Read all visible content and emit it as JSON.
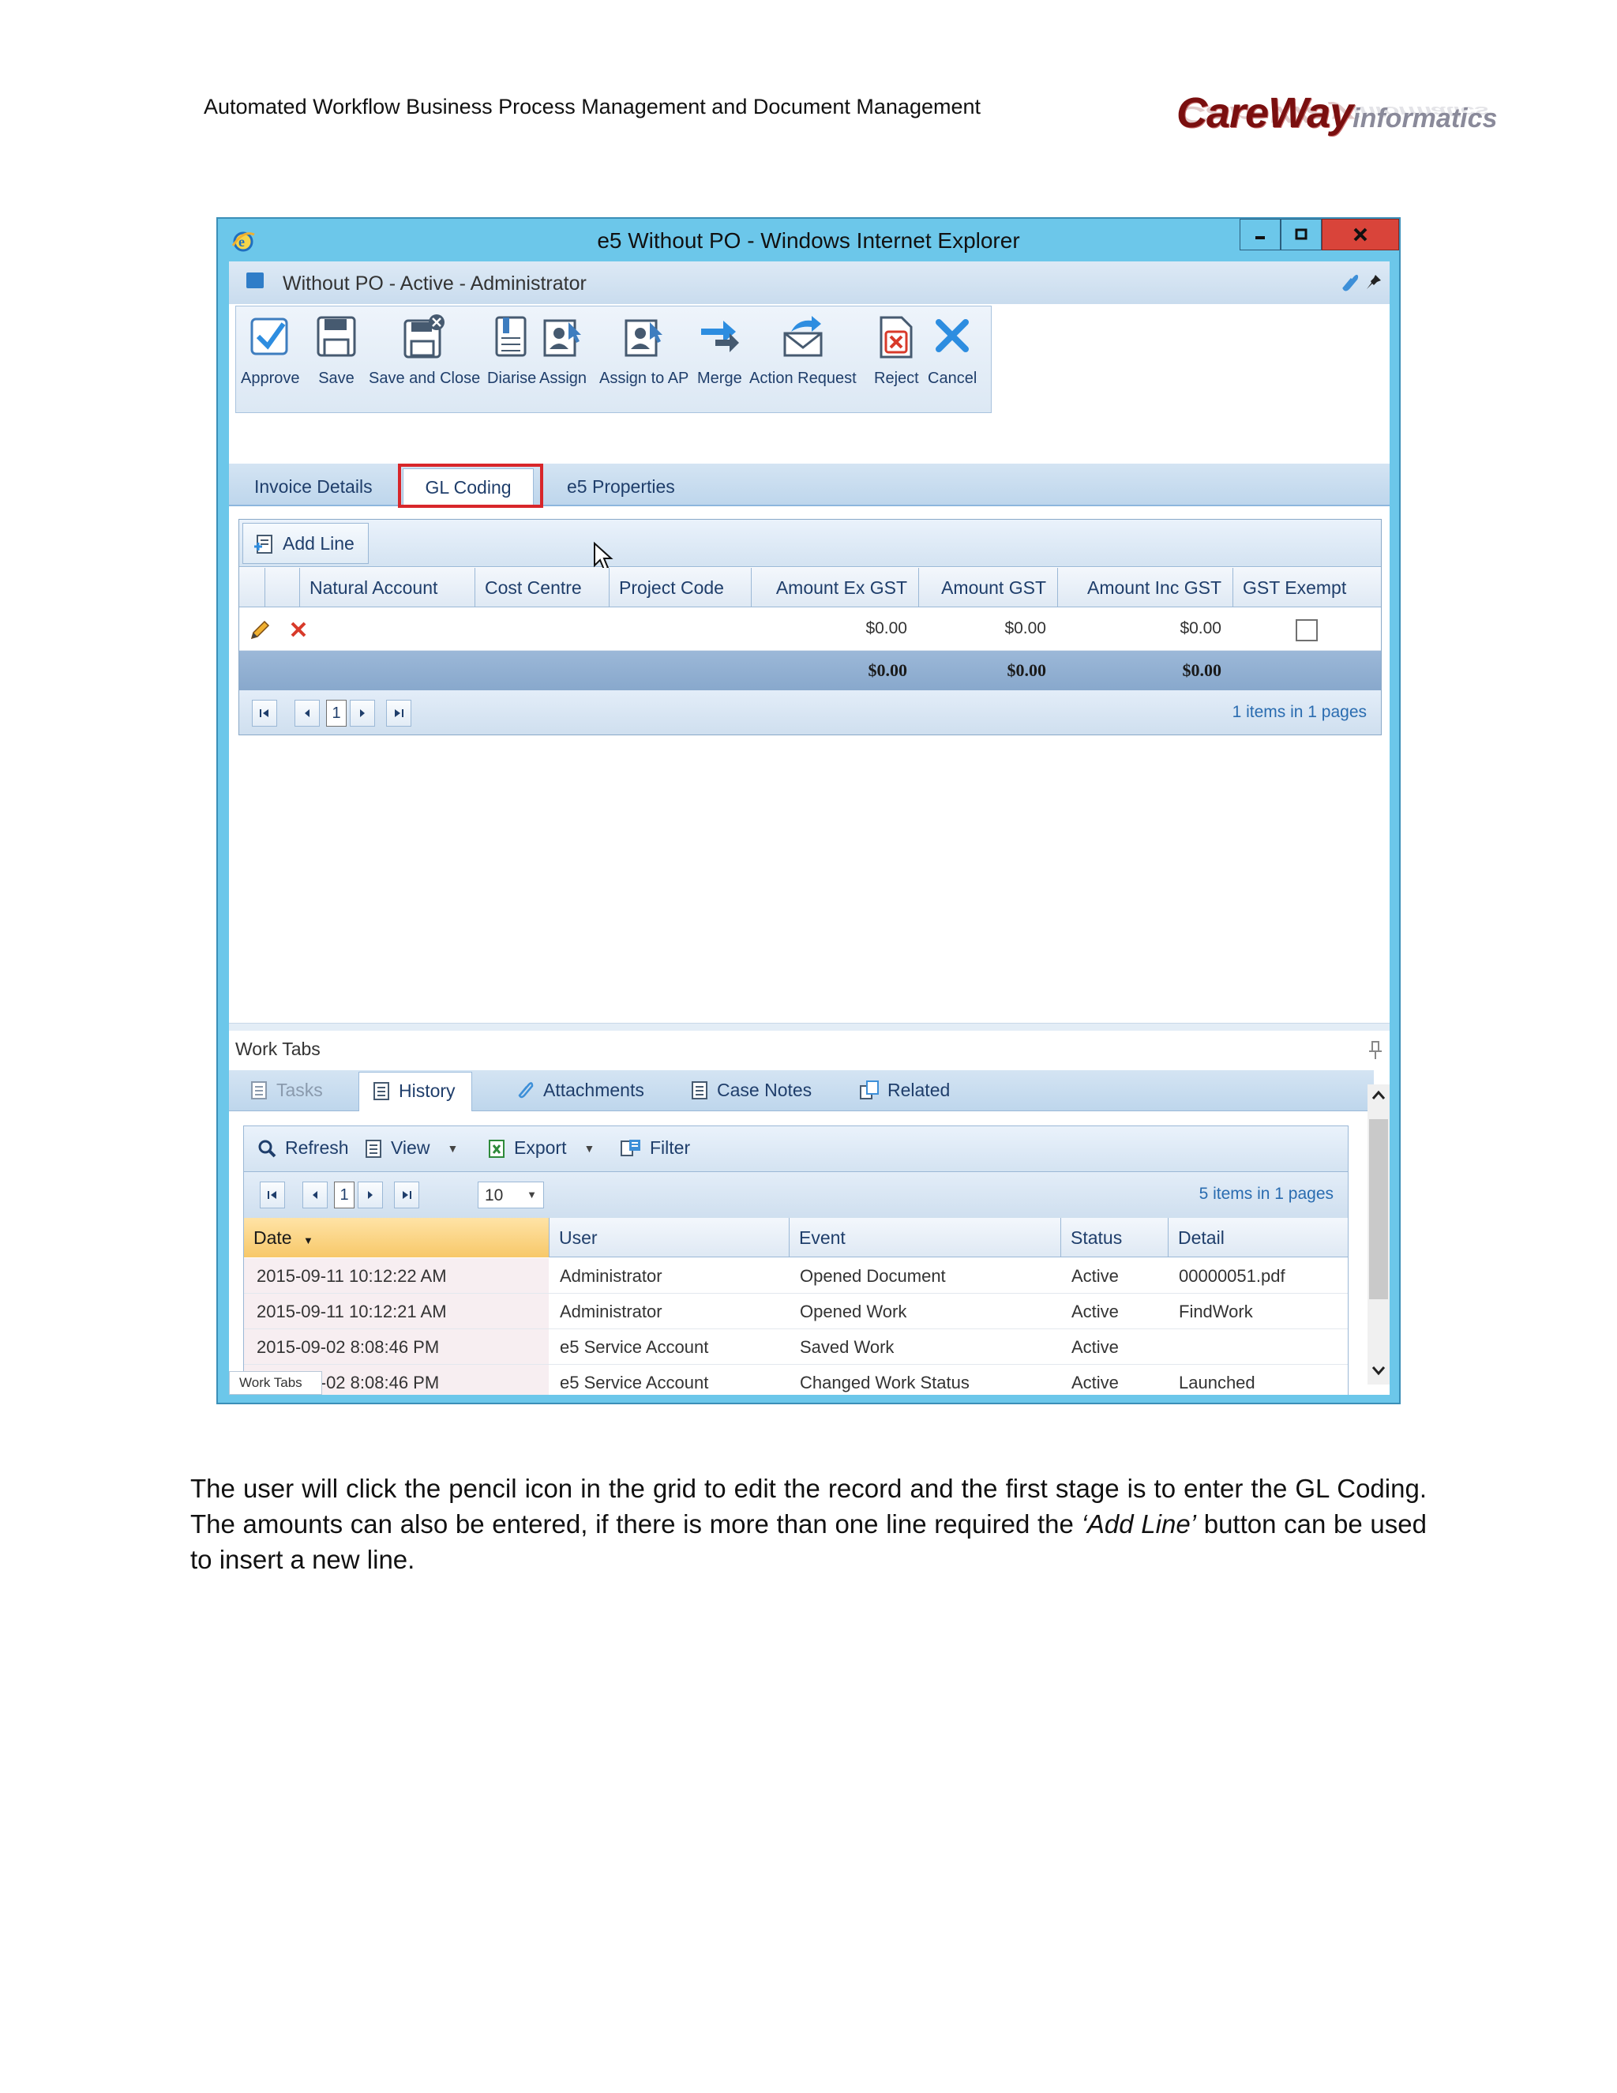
{
  "document": {
    "header_text": "Automated Workflow Business Process Management and Document Management",
    "logo": {
      "main": "CareWay",
      "suffix": "informatics"
    },
    "paragraph": {
      "part1": "The user will click the pencil icon in the grid to edit the record and the first stage is to enter the GL Coding. The amounts can also be entered, if there is more than one line required the ",
      "emphasis": "‘Add Line’",
      "part2": " button can be used to insert a new line."
    }
  },
  "window": {
    "title": "e5 Without PO - Windows Internet Explorer",
    "form_title": "Without PO - Active - Administrator"
  },
  "ribbon": {
    "buttons": [
      "Approve",
      "Save",
      "Save and Close",
      "Diarise",
      "Assign",
      "Assign to AP",
      "Merge",
      "Action Request",
      "Reject",
      "Cancel"
    ]
  },
  "tabs": [
    "Invoice Details",
    "GL Coding",
    "e5 Properties"
  ],
  "active_tab": "GL Coding",
  "gl_grid": {
    "add_line_label": "Add Line",
    "columns": [
      "Natural Account",
      "Cost Centre",
      "Project Code",
      "Amount Ex GST",
      "Amount GST",
      "Amount Inc GST",
      "GST Exempt"
    ],
    "row": {
      "natural_account": "",
      "cost_centre": "",
      "project_code": "",
      "amount_ex_gst": "$0.00",
      "amount_gst": "$0.00",
      "amount_inc_gst": "$0.00",
      "gst_exempt": false
    },
    "totals": {
      "amount_ex_gst": "$0.00",
      "amount_gst": "$0.00",
      "amount_inc_gst": "$0.00"
    },
    "pager": {
      "current_page": "1",
      "info": "1 items in 1 pages"
    }
  },
  "work_tabs": {
    "label": "Work Tabs",
    "tabs": [
      "Tasks",
      "History",
      "Attachments",
      "Case Notes",
      "Related"
    ],
    "active": "History",
    "toolbar": {
      "refresh": "Refresh",
      "view": "View",
      "export": "Export",
      "filter": "Filter"
    },
    "pager": {
      "current_page": "1",
      "page_size": "10",
      "info": "5 items in 1 pages"
    },
    "columns": [
      "Date",
      "User",
      "Event",
      "Status",
      "Detail"
    ],
    "rows": [
      {
        "date": "2015-09-11 10:12:22 AM",
        "user": "Administrator",
        "event": "Opened Document",
        "status": "Active",
        "detail": "00000051.pdf"
      },
      {
        "date": "2015-09-11 10:12:21 AM",
        "user": "Administrator",
        "event": "Opened Work",
        "status": "Active",
        "detail": "FindWork"
      },
      {
        "date": "2015-09-02 8:08:46 PM",
        "user": "e5 Service Account",
        "event": "Saved Work",
        "status": "Active",
        "detail": ""
      },
      {
        "date": "2015-09-02 8:08:46 PM",
        "user": "e5 Service Account",
        "event": "Changed Work Status",
        "status": "Active",
        "detail": "Launched"
      }
    ],
    "bottom_tab": "Work Tabs"
  },
  "colors": {
    "window_frame": "#6cc7ea",
    "close_button": "#d9443a",
    "highlight_box": "#d8262a",
    "sorted_header": "#f7c869",
    "link_blue": "#2a6cb0"
  }
}
